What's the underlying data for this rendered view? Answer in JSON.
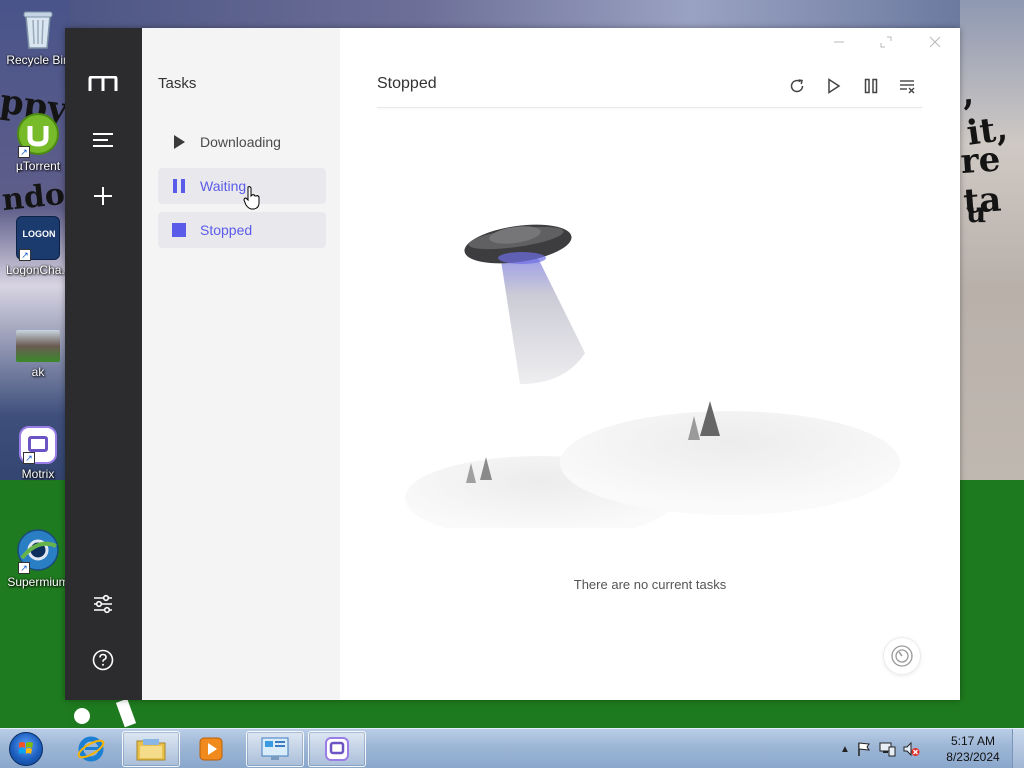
{
  "desktop": {
    "icons": [
      {
        "label": "Recycle Bin"
      },
      {
        "label": "µTorrent"
      },
      {
        "label": "LogonCha..."
      },
      {
        "label": "ak"
      },
      {
        "label": "Motrix"
      },
      {
        "label": "Supermium"
      }
    ],
    "logon_badge": "LOGON"
  },
  "app": {
    "sidebar": {
      "logo_icon": "motrix-logo-icon",
      "menu_icon": "menu-icon",
      "add_icon": "plus-icon",
      "settings_icon": "sliders-icon",
      "help_icon": "help-icon"
    },
    "subnav": {
      "title": "Tasks",
      "items": [
        {
          "label": "Downloading",
          "icon": "play-icon"
        },
        {
          "label": "Waiting",
          "icon": "pause-icon"
        },
        {
          "label": "Stopped",
          "icon": "stop-icon"
        }
      ]
    },
    "main": {
      "title": "Stopped",
      "toolbar": [
        "refresh-icon",
        "play-icon",
        "pause-icon",
        "clear-list-icon"
      ],
      "empty_message": "There are no current tasks"
    },
    "colors": {
      "accent": "#5b5bea",
      "rail": "#2c2c2e",
      "subnav": "#f4f4f5"
    }
  },
  "taskbar": {
    "clock_time": "5:17 AM",
    "clock_date": "8/23/2024",
    "pinned": [
      "internet-explorer-icon",
      "file-explorer-icon",
      "media-player-icon"
    ],
    "open": [
      "control-panel-icon",
      "motrix-taskbar-icon"
    ]
  }
}
